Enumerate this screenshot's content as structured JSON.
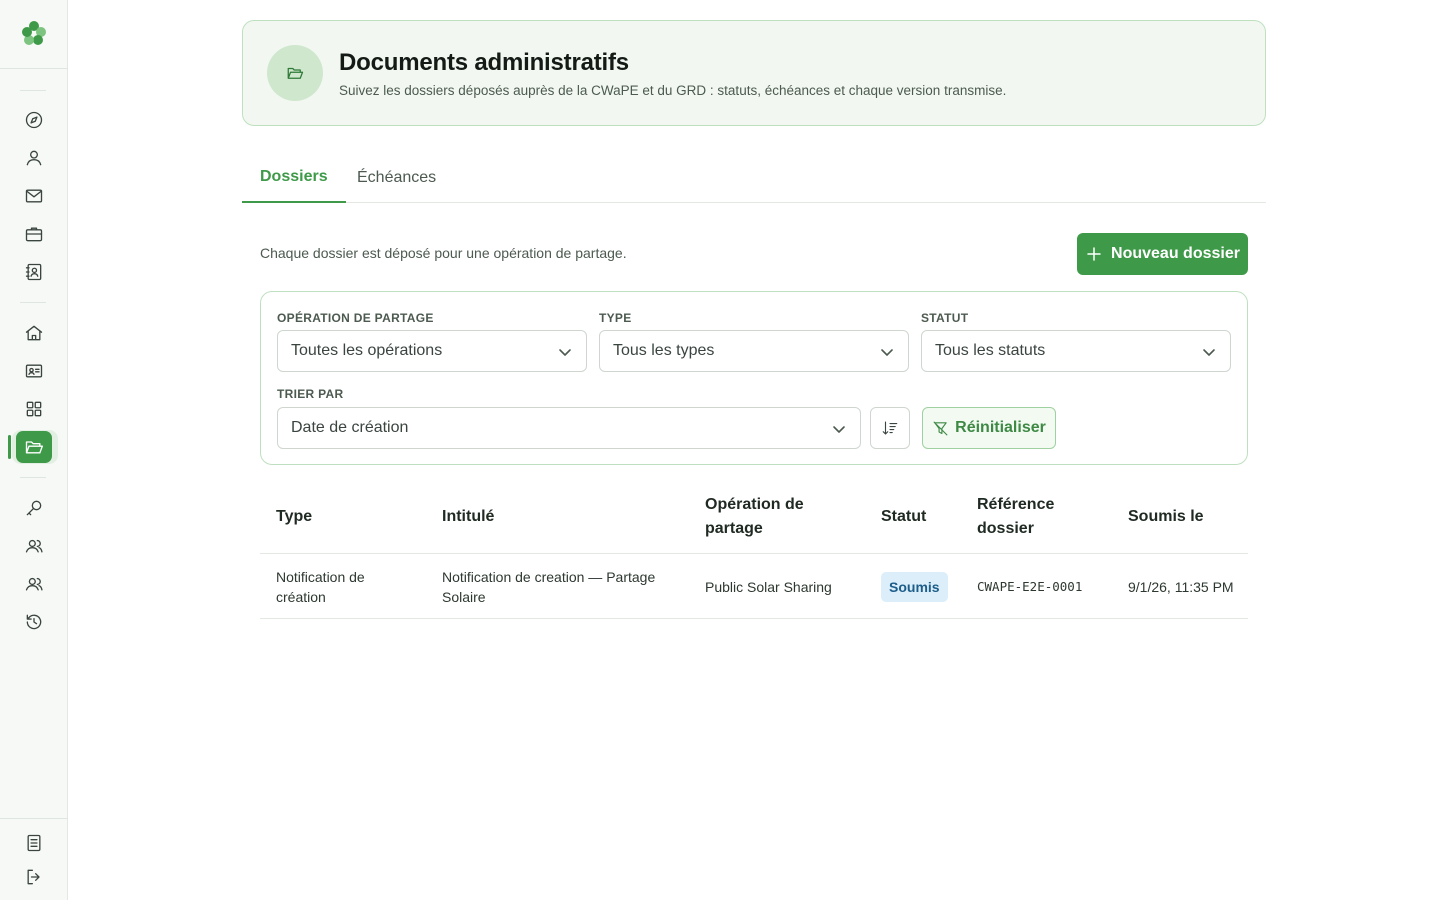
{
  "sidebar": {
    "items": [
      {
        "icon": "compass-icon"
      },
      {
        "icon": "user-icon"
      },
      {
        "icon": "mail-icon"
      },
      {
        "icon": "briefcase-icon"
      },
      {
        "icon": "contact-book-icon"
      },
      {
        "icon": "home-icon"
      },
      {
        "icon": "id-card-icon"
      },
      {
        "icon": "grid-icon"
      },
      {
        "icon": "folder-open-icon",
        "active": true
      },
      {
        "icon": "key-icon"
      },
      {
        "icon": "users-icon"
      },
      {
        "icon": "team-icon"
      },
      {
        "icon": "history-icon"
      }
    ],
    "bottom": [
      {
        "icon": "document-icon"
      },
      {
        "icon": "logout-icon"
      }
    ]
  },
  "header": {
    "title": "Documents administratifs",
    "subtitle": "Suivez les dossiers déposés auprès de la CWaPE et du GRD : statuts, échéances et chaque version transmise."
  },
  "tabs": [
    {
      "label": "Dossiers",
      "active": true
    },
    {
      "label": "Échéances",
      "active": false
    }
  ],
  "main": {
    "intro": "Chaque dossier est déposé pour une opération de partage.",
    "new_button": "Nouveau dossier"
  },
  "filters": {
    "operation_label": "Opération de partage",
    "operation_value": "Toutes les opérations",
    "type_label": "Type",
    "type_value": "Tous les types",
    "status_label": "Statut",
    "status_value": "Tous les statuts",
    "sort_label": "Trier par",
    "sort_value": "Date de création",
    "reset_button": "Réinitialiser"
  },
  "table": {
    "headers": [
      "Type",
      "Intitulé",
      "Opération de partage",
      "Statut",
      "Référence dossier",
      "Soumis le"
    ],
    "rows": [
      {
        "type": "Notification de création",
        "title": "Notification de creation — Partage Solaire",
        "operation": "Public Solar Sharing",
        "status": "Soumis",
        "reference": "CWAPE-E2E-0001",
        "submitted": "9/1/26, 11:35 PM"
      }
    ]
  },
  "colors": {
    "accent": "#3e9a48",
    "badge_bg": "#dbeefa",
    "badge_text": "#1d5d8a"
  }
}
